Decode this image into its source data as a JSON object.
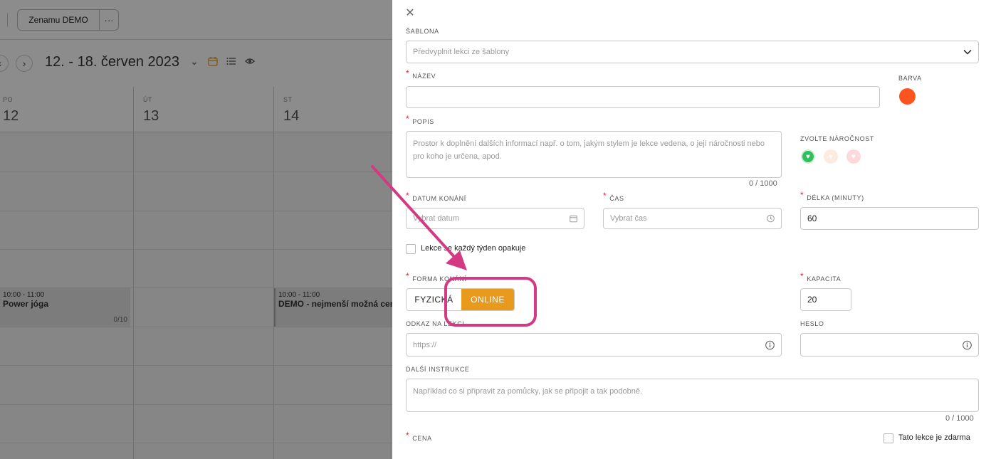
{
  "toolbar": {
    "org_button": "Zenamu DEMO",
    "more_label": "···"
  },
  "calendar": {
    "week_title": "12. - 18. červen 2023",
    "days": [
      {
        "name": "PO",
        "date": "12"
      },
      {
        "name": "ÚT",
        "date": "13"
      },
      {
        "name": "ST",
        "date": "14"
      }
    ],
    "events": [
      {
        "time": "10:00 - 11:00",
        "name": "Power jóga",
        "capacity": "0/10"
      },
      {
        "time": "10:00 - 11:00",
        "name": "DEMO - nejmenší možná cena"
      }
    ]
  },
  "form": {
    "template_label": "ŠABLONA",
    "template_placeholder": "Předvyplnit lekci ze šablony",
    "name_label": "NÁZEV",
    "name_value": "",
    "color_label": "BARVA",
    "color_value": "#fb541f",
    "desc_label": "POPIS",
    "desc_placeholder": "Prostor k doplnění dalších informací např. o tom, jakým stylem je lekce vedena, o její náročnosti nebo pro koho je určena, apod.",
    "desc_counter": "0 / 1000",
    "difficulty_label": "ZVOLTE NÁROČNOST",
    "date_label": "DATUM KONÁNÍ",
    "date_placeholder": "Vybrat datum",
    "time_label": "ČAS",
    "time_placeholder": "Vybrat čas",
    "duration_label": "DÉLKA (MINUTY)",
    "duration_value": "60",
    "repeat_label": "Lekce se každý týden opakuje",
    "form_label": "FORMA KONÁNÍ",
    "form_options": [
      "FYZICKÁ",
      "ONLINE"
    ],
    "form_selected": "ONLINE",
    "capacity_label": "KAPACITA",
    "capacity_value": "20",
    "link_label": "ODKAZ NA LEKCI",
    "link_placeholder": "https://",
    "password_label": "HESLO",
    "password_value": "",
    "instructions_label": "DALŠÍ INSTRUKCE",
    "instructions_placeholder": "Například co si připravit za pomůcky, jak se připojit a tak podobně.",
    "instructions_counter": "0 / 1000",
    "price_label": "CENA",
    "free_label": "Tato lekce je zdarma"
  },
  "colors": {
    "accent": "#e89a1d",
    "required": "#e0243a",
    "highlight": "#d43a84",
    "difficulty_easy": "#2fbf5b"
  }
}
